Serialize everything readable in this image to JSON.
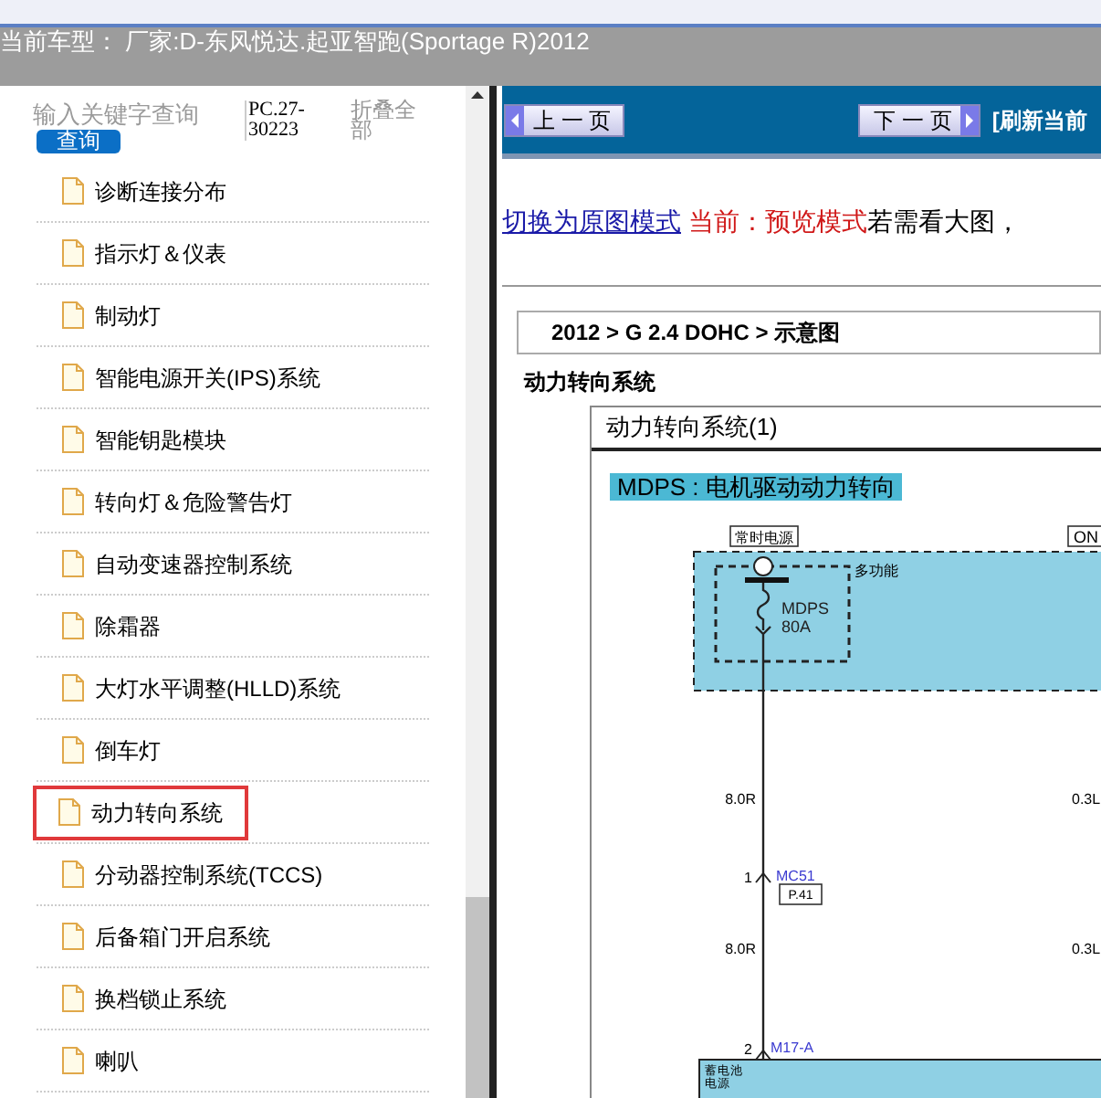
{
  "header": {
    "car_model": "当前车型：  厂家:D-东风悦达.起亚智跑(Sportage R)2012"
  },
  "sidebar": {
    "search_placeholder": "输入关键字查询",
    "search_button": "查询",
    "code": "PC.27-30223",
    "collapse_all": "折叠全部",
    "items": [
      {
        "label": "诊断连接分布",
        "selected": false
      },
      {
        "label": "指示灯＆仪表",
        "selected": false
      },
      {
        "label": "制动灯",
        "selected": false
      },
      {
        "label": "智能电源开关(IPS)系统",
        "selected": false
      },
      {
        "label": "智能钥匙模块",
        "selected": false
      },
      {
        "label": "转向灯＆危险警告灯",
        "selected": false
      },
      {
        "label": "自动变速器控制系统",
        "selected": false
      },
      {
        "label": "除霜器",
        "selected": false
      },
      {
        "label": "大灯水平调整(HLLD)系统",
        "selected": false
      },
      {
        "label": "倒车灯",
        "selected": false
      },
      {
        "label": "动力转向系统",
        "selected": true
      },
      {
        "label": "分动器控制系统(TCCS)",
        "selected": false
      },
      {
        "label": "后备箱门开启系统",
        "selected": false
      },
      {
        "label": "换档锁止系统",
        "selected": false
      },
      {
        "label": "喇叭",
        "selected": false
      }
    ]
  },
  "viewer": {
    "prev_button": "上 一 页",
    "next_button": "下 一 页",
    "refresh": "[刷新当前",
    "mode_link": "切换为原图模式",
    "mode_status": "当前：预览模式",
    "hint": "若需看大图，",
    "breadcrumb": "2012 > G 2.4 DOHC > 示意图",
    "section_title": "动力转向系统",
    "diagram": {
      "title": "动力转向系统(1)",
      "heading": "MDPS : 电机驱动动力转向",
      "power_label": "常时电源",
      "ignition_label": "ON",
      "fuse_box": "多功能",
      "fuse_name": "MDPS",
      "fuse_rating": "80A",
      "wire_left_upper": "8.0R",
      "wire_right_upper": "0.3L",
      "pin_upper": "1",
      "connector_upper": "MC51",
      "page_ref": "P.41",
      "wire_left_lower": "8.0R",
      "wire_right_lower": "0.3L",
      "pin_lower": "2",
      "connector_lower": "M17-A",
      "module_label_1": "蓄电池",
      "module_label_2": "电源"
    }
  }
}
